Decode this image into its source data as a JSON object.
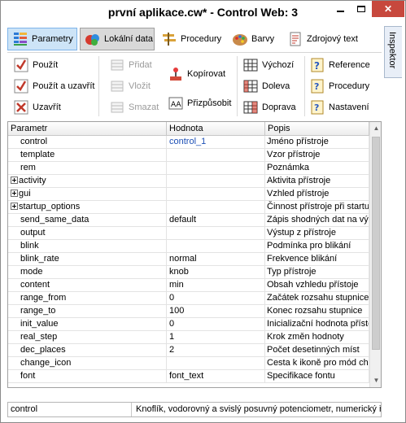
{
  "window": {
    "title": "první aplikace.cw* - Control Web: 3"
  },
  "tabs": [
    {
      "label": "Parametry",
      "icon": "parameters-icon"
    },
    {
      "label": "Lokální data",
      "icon": "local-data-icon"
    },
    {
      "label": "Procedury",
      "icon": "procedures-icon"
    },
    {
      "label": "Barvy",
      "icon": "palette-icon"
    },
    {
      "label": "Zdrojový text",
      "icon": "source-text-icon"
    }
  ],
  "ribbon": {
    "use": "Použít",
    "use_close": "Použít a uzavřít",
    "close": "Uzavřít",
    "add": "Přidat",
    "insert": "Vložit",
    "delete": "Smazat",
    "copy": "Kopírovat",
    "adjust": "Přizpůsobit",
    "default": "Výchozí",
    "left": "Doleva",
    "right": "Doprava",
    "reference": "Reference",
    "procedure": "Procedury",
    "settings": "Nastavení"
  },
  "side_tab": {
    "label": "Inspektor"
  },
  "grid": {
    "headers": [
      "Parametr",
      "Hodnota",
      "Popis"
    ],
    "rows": [
      {
        "name": "control",
        "value": "control_1",
        "desc": "Jméno přístroje",
        "expandable": false,
        "link": true
      },
      {
        "name": "template",
        "value": "",
        "desc": "Vzor přístroje",
        "expandable": false
      },
      {
        "name": "rem",
        "value": "",
        "desc": "Poznámka",
        "expandable": false
      },
      {
        "name": "activity",
        "value": "",
        "desc": "Aktivita přístroje",
        "expandable": true
      },
      {
        "name": "gui",
        "value": "",
        "desc": "Vzhled přístroje",
        "expandable": true
      },
      {
        "name": "startup_options",
        "value": "",
        "desc": "Činnost přístroje při startu",
        "expandable": true
      },
      {
        "name": "send_same_data",
        "value": "default",
        "desc": "Zápis shodných dat na vý",
        "expandable": false
      },
      {
        "name": "output",
        "value": "",
        "desc": "Výstup z přístroje",
        "expandable": false
      },
      {
        "name": "blink",
        "value": "",
        "desc": "Podmínka pro blikání",
        "expandable": false
      },
      {
        "name": "blink_rate",
        "value": "normal",
        "desc": "Frekvence blikání",
        "expandable": false
      },
      {
        "name": "mode",
        "value": "knob",
        "desc": "Typ přístroje",
        "expandable": false
      },
      {
        "name": "content",
        "value": "min",
        "desc": "Obsah vzhledu přístoje",
        "expandable": false
      },
      {
        "name": "range_from",
        "value": "0",
        "desc": "Začátek rozsahu stupnice",
        "expandable": false
      },
      {
        "name": "range_to",
        "value": "100",
        "desc": "Konec rozsahu stupnice",
        "expandable": false
      },
      {
        "name": "init_value",
        "value": "0",
        "desc": "Inicializační hodnota přísto",
        "expandable": false
      },
      {
        "name": "real_step",
        "value": "1",
        "desc": "Krok změn hodnoty",
        "expandable": false
      },
      {
        "name": "dec_places",
        "value": "2",
        "desc": "Počet desetinných míst",
        "expandable": false
      },
      {
        "name": "change_icon",
        "value": "",
        "desc": "Cesta k ikoně pro mód cha",
        "expandable": false
      },
      {
        "name": "font",
        "value": "font_text",
        "desc": "Specifikace fontu",
        "expandable": false
      }
    ]
  },
  "status": {
    "left": "control",
    "right": "Knoflík, vodorovný a svislý posuvný potenciometr, numerický řá"
  },
  "colors": {
    "active_tab": "#cde4f7",
    "close_button": "#c7483d",
    "link": "#1c4fb5"
  }
}
